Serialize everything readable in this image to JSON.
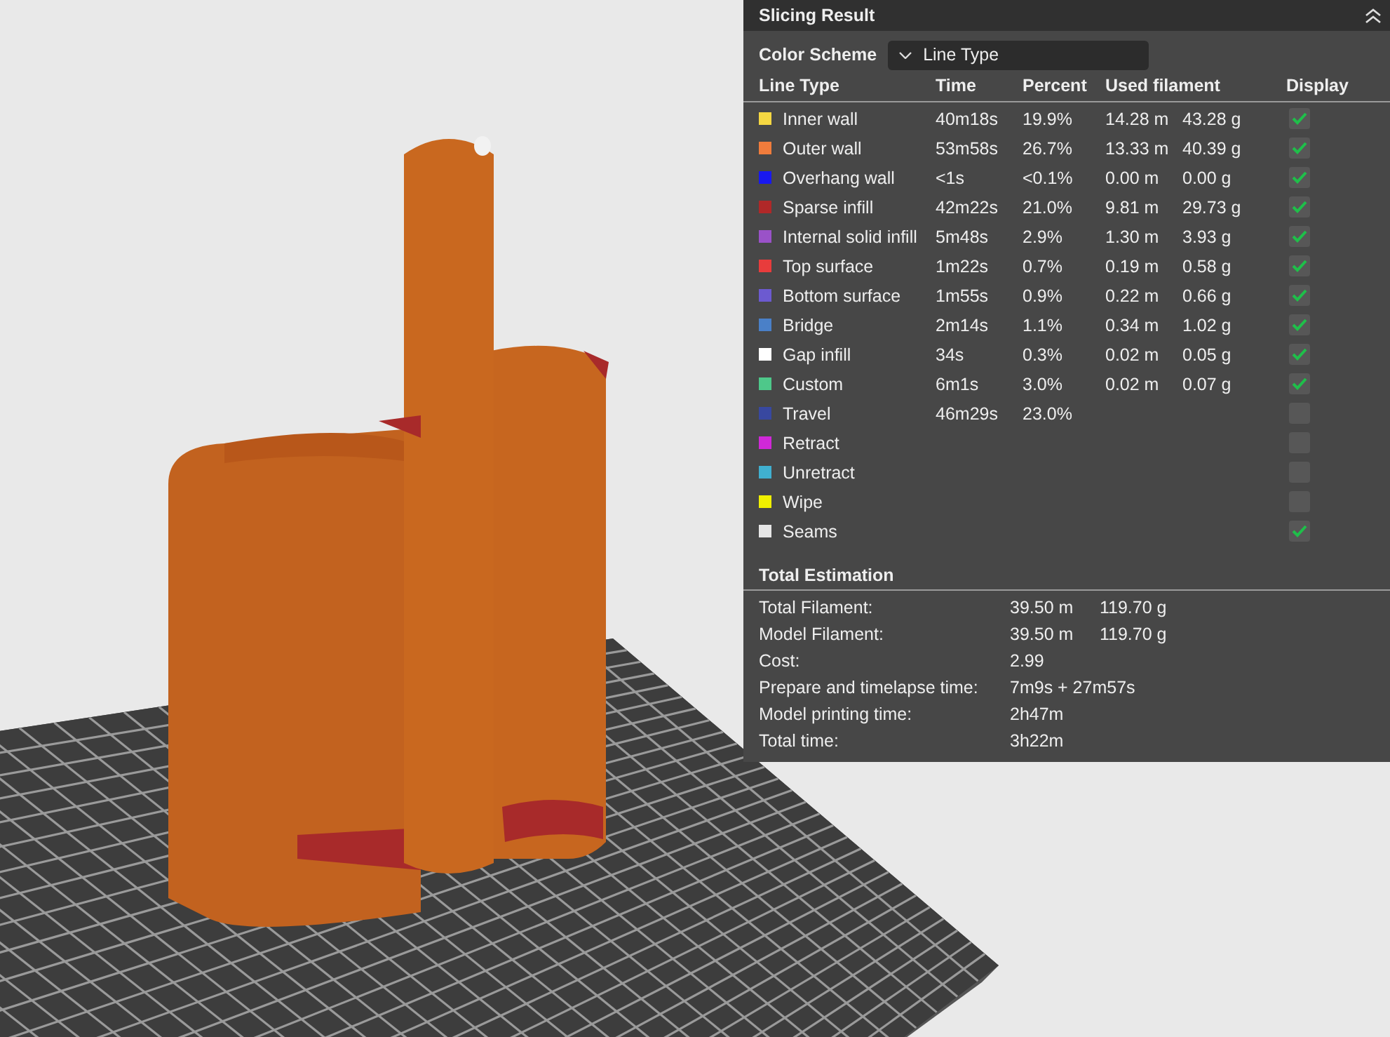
{
  "panel": {
    "title": "Slicing Result",
    "color_scheme": {
      "label": "Color Scheme",
      "value": "Line Type"
    },
    "columns": [
      "Line Type",
      "Time",
      "Percent",
      "Used filament",
      "Display"
    ],
    "rows": [
      {
        "name": "Inner wall",
        "color": "#f5d742",
        "time": "40m18s",
        "percent": "19.9%",
        "length": "14.28 m",
        "weight": "43.28 g",
        "display": true
      },
      {
        "name": "Outer wall",
        "color": "#f07c3c",
        "time": "53m58s",
        "percent": "26.7%",
        "length": "13.33 m",
        "weight": "40.39 g",
        "display": true
      },
      {
        "name": "Overhang wall",
        "color": "#1818f0",
        "time": "<1s",
        "percent": "<0.1%",
        "length": "0.00 m",
        "weight": "0.00 g",
        "display": true
      },
      {
        "name": "Sparse infill",
        "color": "#b02828",
        "time": "42m22s",
        "percent": "21.0%",
        "length": "9.81 m",
        "weight": "29.73 g",
        "display": true
      },
      {
        "name": "Internal solid infill",
        "color": "#9a52c8",
        "time": "5m48s",
        "percent": "2.9%",
        "length": "1.30 m",
        "weight": "3.93 g",
        "display": true
      },
      {
        "name": "Top surface",
        "color": "#e83c3c",
        "time": "1m22s",
        "percent": "0.7%",
        "length": "0.19 m",
        "weight": "0.58 g",
        "display": true
      },
      {
        "name": "Bottom surface",
        "color": "#6c5ad0",
        "time": "1m55s",
        "percent": "0.9%",
        "length": "0.22 m",
        "weight": "0.66 g",
        "display": true
      },
      {
        "name": "Bridge",
        "color": "#4a80c8",
        "time": "2m14s",
        "percent": "1.1%",
        "length": "0.34 m",
        "weight": "1.02 g",
        "display": true
      },
      {
        "name": "Gap infill",
        "color": "#ffffff",
        "time": "34s",
        "percent": "0.3%",
        "length": "0.02 m",
        "weight": "0.05 g",
        "display": true
      },
      {
        "name": "Custom",
        "color": "#4ec88a",
        "time": "6m1s",
        "percent": "3.0%",
        "length": "0.02 m",
        "weight": "0.07 g",
        "display": true
      },
      {
        "name": "Travel",
        "color": "#3848a0",
        "time": "46m29s",
        "percent": "23.0%",
        "display": false
      },
      {
        "name": "Retract",
        "color": "#d028d8",
        "display": false
      },
      {
        "name": "Unretract",
        "color": "#40b0d0",
        "display": false
      },
      {
        "name": "Wipe",
        "color": "#f0f000",
        "display": false
      },
      {
        "name": "Seams",
        "color": "#e6e6e6",
        "display": true
      }
    ],
    "total_estimation": {
      "title": "Total Estimation",
      "rows": [
        {
          "label": "Total Filament:",
          "values": [
            "39.50 m",
            "119.70 g"
          ]
        },
        {
          "label": "Model Filament:",
          "values": [
            "39.50 m",
            "119.70 g"
          ]
        },
        {
          "label": "Cost:",
          "values": [
            "2.99"
          ]
        },
        {
          "label": "Prepare and timelapse time:",
          "values": [
            "7m9s + 27m57s"
          ]
        },
        {
          "label": "Model printing time:",
          "values": [
            "2h47m"
          ]
        },
        {
          "label": "Total time:",
          "values": [
            "3h22m"
          ]
        }
      ]
    }
  }
}
